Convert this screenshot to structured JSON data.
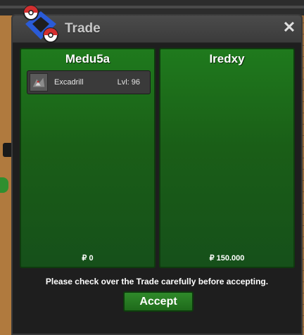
{
  "window": {
    "title": "Trade",
    "close_icon": "close-icon"
  },
  "trade": {
    "left": {
      "player": "Medu5a",
      "items": [
        {
          "name": "Excadrill",
          "level": "Lvl: 96",
          "icon": "excadrill-sprite-icon"
        }
      ],
      "money": "₽ 0"
    },
    "right": {
      "player": "Iredxy",
      "items": [],
      "money": "₽ 150.000"
    },
    "notice": "Please check over the Trade carefully before accepting.",
    "accept_label": "Accept"
  },
  "colors": {
    "panel_green": "#1f7a1d",
    "window_bg": "#1e1e1e",
    "title_text": "#c8c8c8",
    "pokeball_red": "#d32f2f",
    "logo_blue": "#2a5bd7"
  }
}
